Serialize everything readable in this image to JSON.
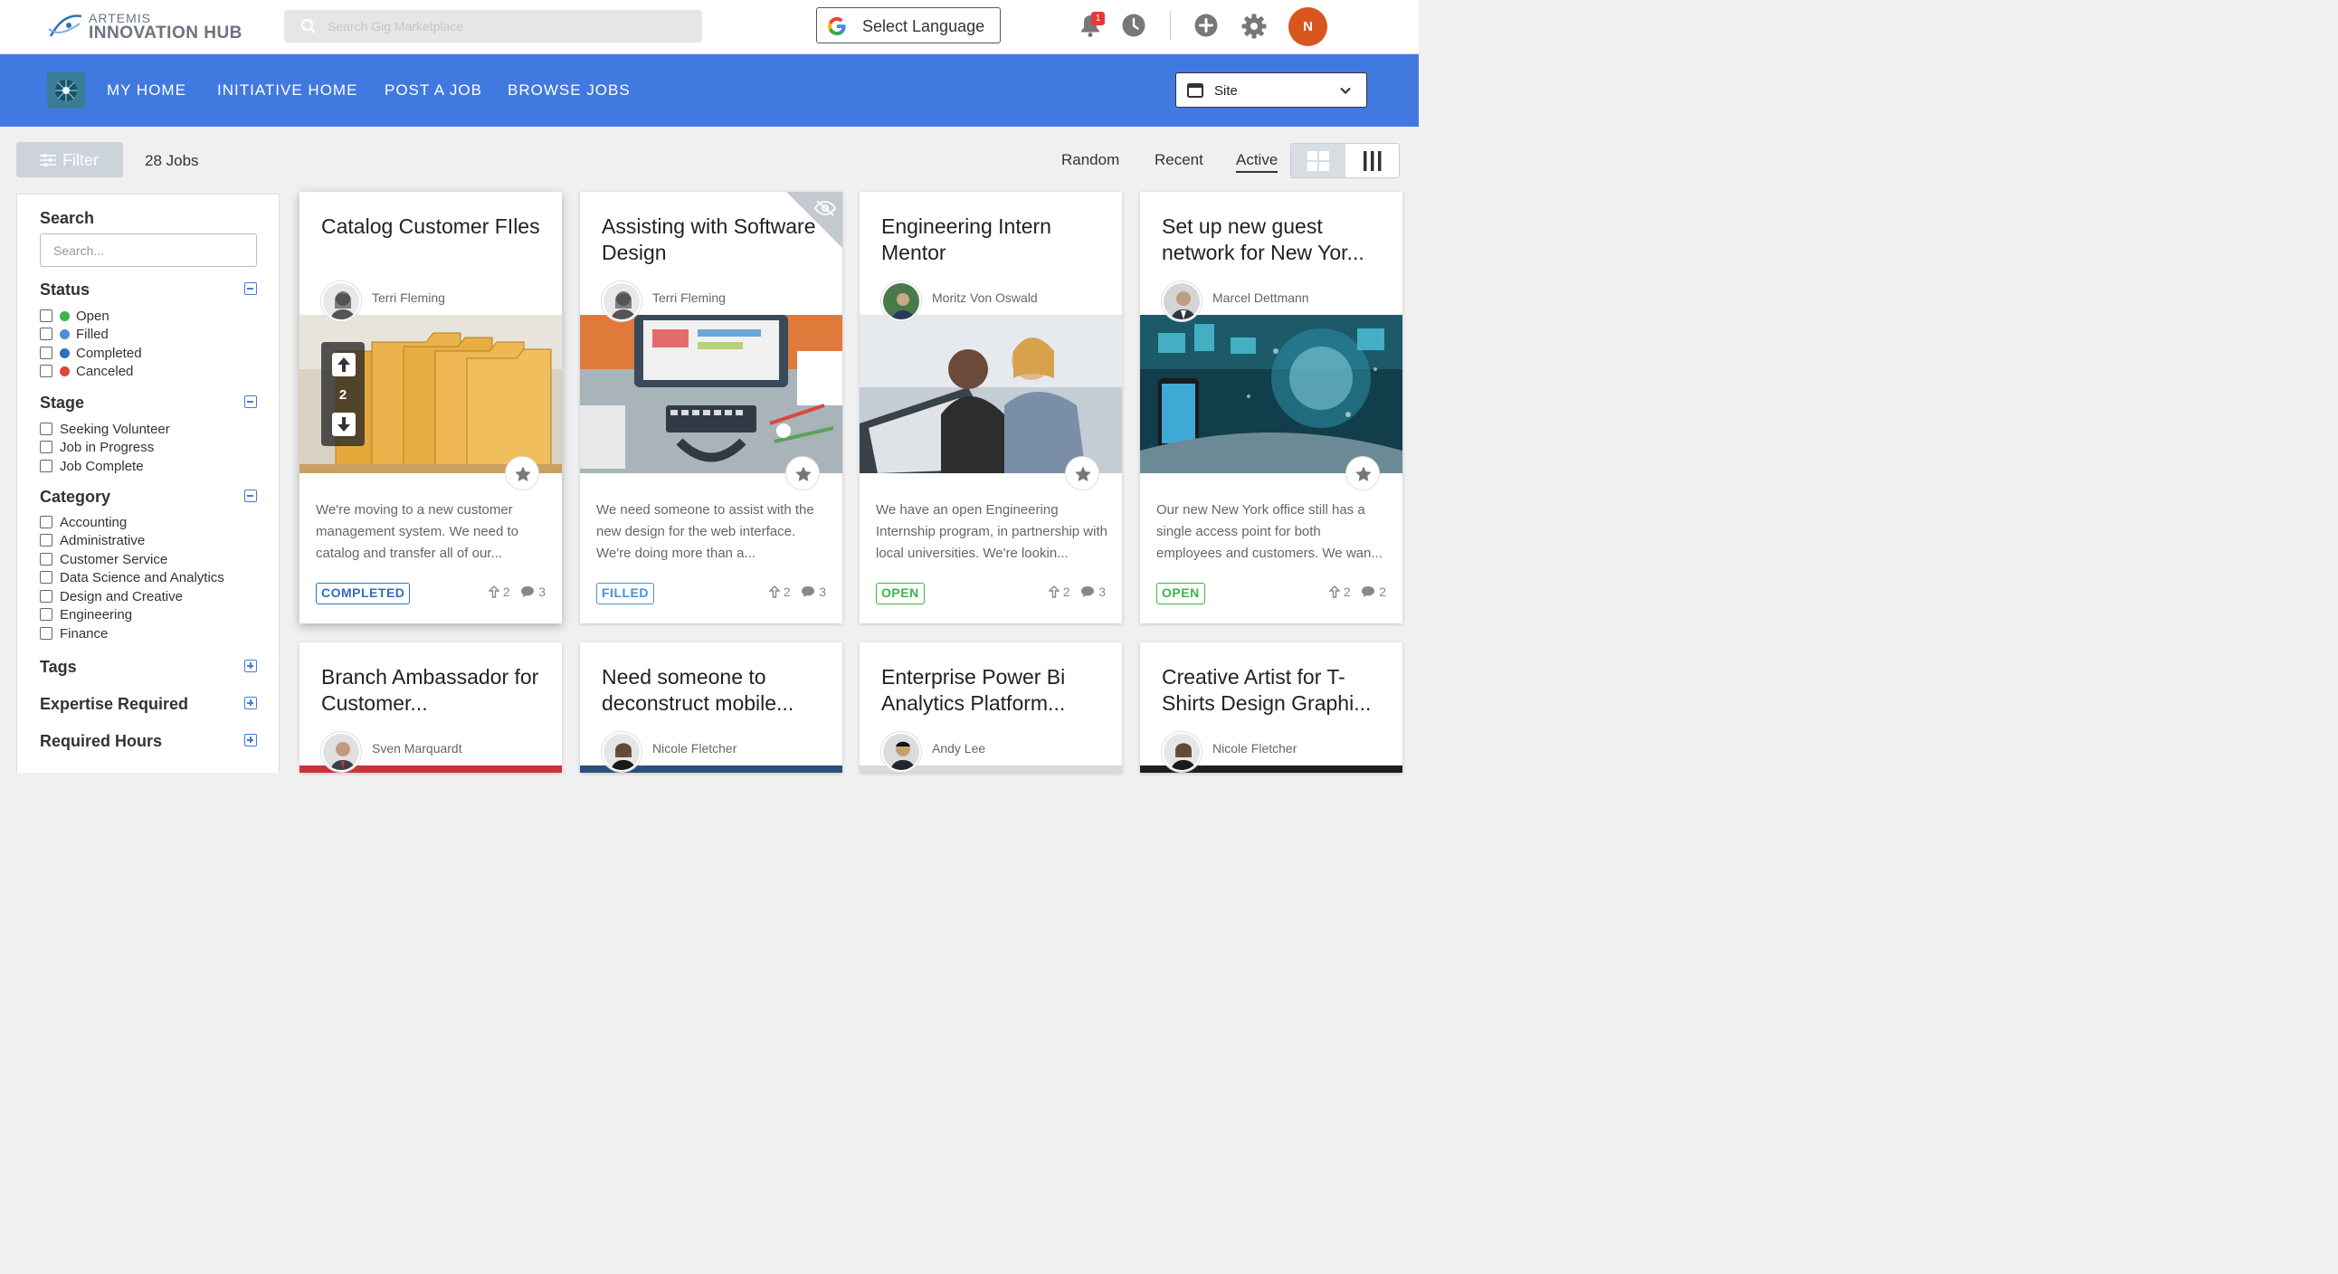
{
  "header": {
    "logo_line1": "ARTEMIS",
    "logo_line2": "INNOVATION HUB",
    "search_placeholder": "Search Gig Marketplace",
    "language_label": "Select Language",
    "notification_count": "1",
    "user_initial": "N"
  },
  "nav": {
    "items": [
      "MY HOME",
      "INITIATIVE HOME",
      "POST A JOB",
      "BROWSE JOBS"
    ],
    "site_label": "Site"
  },
  "toolbar": {
    "filter_label": "Filter",
    "jobs_count": "28 Jobs",
    "sort_options": [
      "Random",
      "Recent",
      "Active"
    ],
    "active_sort": "Active"
  },
  "sidebar": {
    "search_heading": "Search",
    "search_placeholder": "Search...",
    "status_heading": "Status",
    "status_items": [
      {
        "label": "Open",
        "color": "#3cb44b"
      },
      {
        "label": "Filled",
        "color": "#4a90d9"
      },
      {
        "label": "Completed",
        "color": "#2f6fbd"
      },
      {
        "label": "Canceled",
        "color": "#e0453a"
      }
    ],
    "stage_heading": "Stage",
    "stage_items": [
      "Seeking Volunteer",
      "Job in Progress",
      "Job Complete"
    ],
    "category_heading": "Category",
    "category_items": [
      "Accounting",
      "Administrative",
      "Customer Service",
      "Data Science and Analytics",
      "Design and Creative",
      "Engineering",
      "Finance"
    ],
    "tags_heading": "Tags",
    "expertise_heading": "Expertise Required",
    "hours_heading": "Required Hours"
  },
  "cards": [
    {
      "title": "Catalog Customer FIles",
      "owner": "Terri Fleming",
      "description": "We're moving to a new customer management system. We need to catalog and transfer all of our...",
      "status": "COMPLETED",
      "status_color": "#2f6fbd",
      "upvotes": "2",
      "comments": "3",
      "vote_count": "2"
    },
    {
      "title": "Assisting with Software Design",
      "owner": "Terri Fleming",
      "description": "We need someone to assist with the new design for the web interface. We're doing more than a...",
      "status": "FILLED",
      "status_color": "#4a90d9",
      "upvotes": "2",
      "comments": "3"
    },
    {
      "title": "Engineering Intern Mentor",
      "owner": "Moritz Von Oswald",
      "description": "We have an open Engineering Internship program, in partnership with local universities. We're lookin...",
      "status": "OPEN",
      "status_color": "#3cb44b",
      "upvotes": "2",
      "comments": "3"
    },
    {
      "title": "Set up new guest network for New Yor...",
      "owner": "Marcel Dettmann",
      "description": "Our new New York office still has a single access point for both employees and customers. We wan...",
      "status": "OPEN",
      "status_color": "#3cb44b",
      "upvotes": "2",
      "comments": "2"
    },
    {
      "title": "Branch Ambassador for Customer...",
      "owner": "Sven Marquardt"
    },
    {
      "title": "Need someone to deconstruct mobile...",
      "owner": "Nicole Fletcher"
    },
    {
      "title": "Enterprise Power Bi Analytics Platform...",
      "owner": "Andy Lee"
    },
    {
      "title": "Creative Artist for T-Shirts Design Graphi...",
      "owner": "Nicole Fletcher"
    }
  ]
}
